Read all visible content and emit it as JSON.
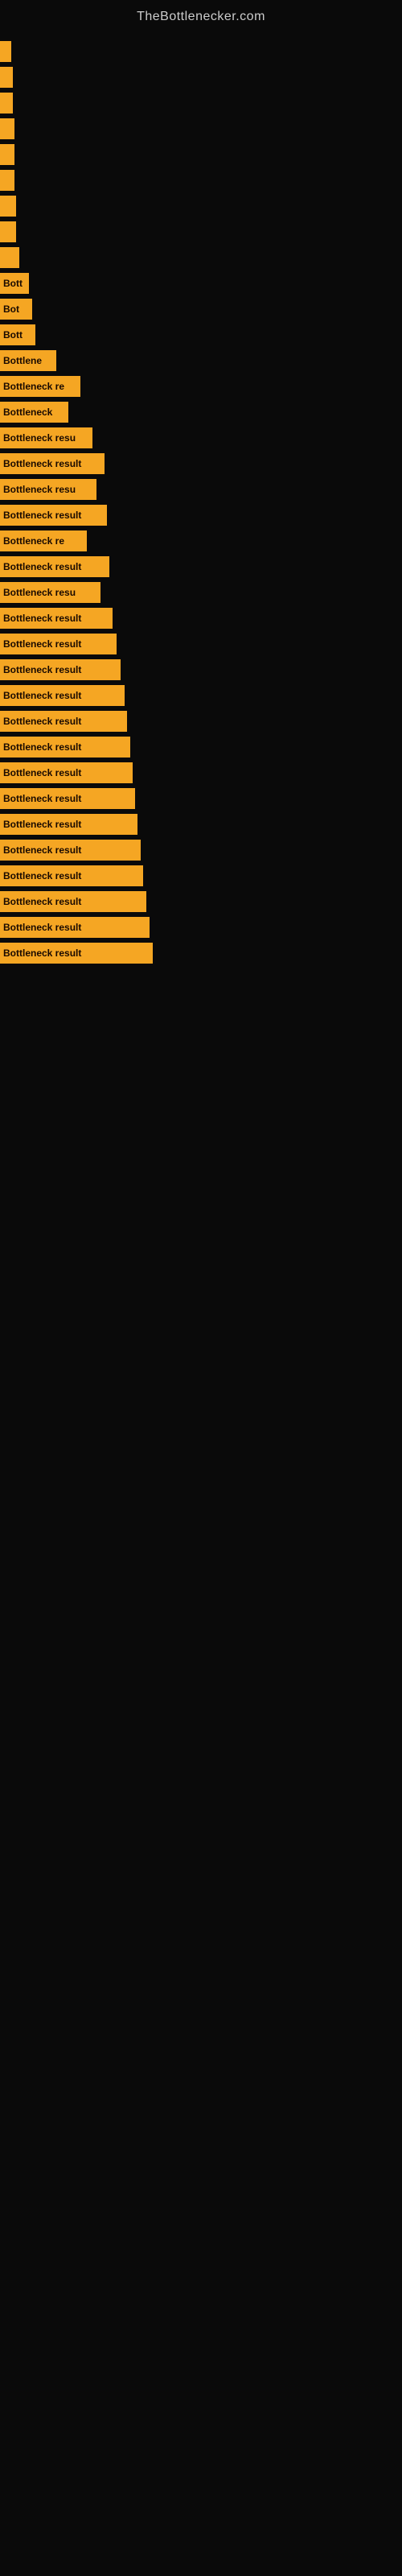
{
  "site_title": "TheBottlenecker.com",
  "bars": [
    {
      "label": "",
      "width": 14,
      "text": ""
    },
    {
      "label": "",
      "width": 16,
      "text": ""
    },
    {
      "label": "",
      "width": 16,
      "text": ""
    },
    {
      "label": "",
      "width": 18,
      "text": ""
    },
    {
      "label": "",
      "width": 18,
      "text": ""
    },
    {
      "label": "",
      "width": 18,
      "text": ""
    },
    {
      "label": "",
      "width": 20,
      "text": ""
    },
    {
      "label": "",
      "width": 20,
      "text": ""
    },
    {
      "label": "",
      "width": 24,
      "text": ""
    },
    {
      "label": "Bott",
      "width": 36,
      "text": "Bott"
    },
    {
      "label": "Bot",
      "width": 40,
      "text": "Bot"
    },
    {
      "label": "Bott",
      "width": 44,
      "text": "Bott"
    },
    {
      "label": "Bottlene",
      "width": 70,
      "text": "Bottlene"
    },
    {
      "label": "Bottleneck re",
      "width": 100,
      "text": "Bottleneck re"
    },
    {
      "label": "Bottleneck",
      "width": 85,
      "text": "Bottleneck"
    },
    {
      "label": "Bottleneck resu",
      "width": 115,
      "text": "Bottleneck resu"
    },
    {
      "label": "Bottleneck result",
      "width": 130,
      "text": "Bottleneck result"
    },
    {
      "label": "Bottleneck resu",
      "width": 120,
      "text": "Bottleneck resu"
    },
    {
      "label": "Bottleneck result",
      "width": 133,
      "text": "Bottleneck result"
    },
    {
      "label": "Bottleneck re",
      "width": 108,
      "text": "Bottleneck re"
    },
    {
      "label": "Bottleneck result",
      "width": 136,
      "text": "Bottleneck result"
    },
    {
      "label": "Bottleneck resu",
      "width": 125,
      "text": "Bottleneck resu"
    },
    {
      "label": "Bottleneck result",
      "width": 140,
      "text": "Bottleneck result"
    },
    {
      "label": "Bottleneck result",
      "width": 145,
      "text": "Bottleneck result"
    },
    {
      "label": "Bottleneck result",
      "width": 150,
      "text": "Bottleneck result"
    },
    {
      "label": "Bottleneck result",
      "width": 155,
      "text": "Bottleneck result"
    },
    {
      "label": "Bottleneck result",
      "width": 158,
      "text": "Bottleneck result"
    },
    {
      "label": "Bottleneck result",
      "width": 162,
      "text": "Bottleneck result"
    },
    {
      "label": "Bottleneck result",
      "width": 165,
      "text": "Bottleneck result"
    },
    {
      "label": "Bottleneck result",
      "width": 168,
      "text": "Bottleneck result"
    },
    {
      "label": "Bottleneck result",
      "width": 171,
      "text": "Bottleneck result"
    },
    {
      "label": "Bottleneck result",
      "width": 175,
      "text": "Bottleneck result"
    },
    {
      "label": "Bottleneck result",
      "width": 178,
      "text": "Bottleneck result"
    },
    {
      "label": "Bottleneck result",
      "width": 182,
      "text": "Bottleneck result"
    },
    {
      "label": "Bottleneck result",
      "width": 186,
      "text": "Bottleneck result"
    },
    {
      "label": "Bottleneck result",
      "width": 190,
      "text": "Bottleneck result"
    }
  ]
}
